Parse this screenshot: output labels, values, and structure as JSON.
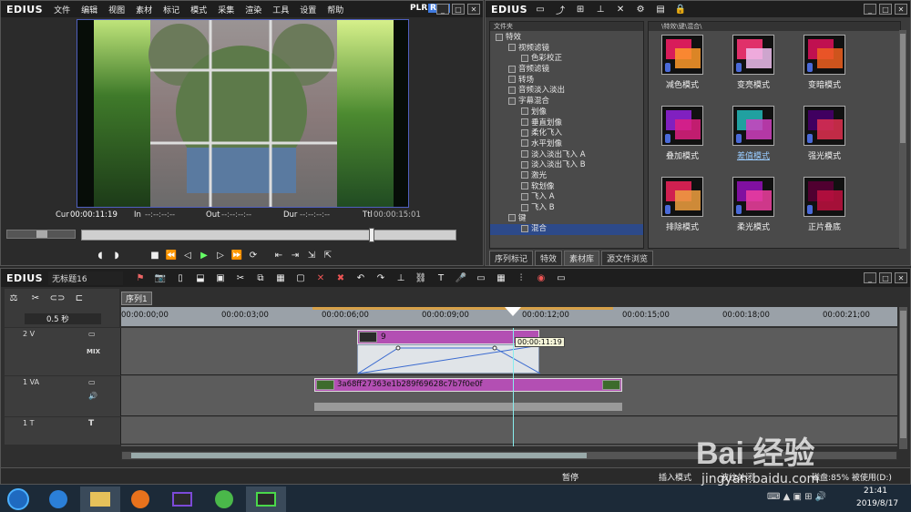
{
  "player": {
    "logo": "EDIUS",
    "menu": [
      "文件",
      "编辑",
      "视图",
      "素材",
      "标记",
      "模式",
      "采集",
      "渲染",
      "工具",
      "设置",
      "帮助"
    ],
    "plr": "PLR",
    "rec": "REC",
    "cur_label": "Cur",
    "cur": "00:00:11:19",
    "in_label": "In",
    "in": "--:--:--:--",
    "out_label": "Out",
    "out": "--:--:--:--",
    "dur_label": "Dur",
    "dur": "--:--:--:--",
    "ttl_label": "Ttl",
    "ttl": "00:00:15:01"
  },
  "bin": {
    "logo": "EDIUS",
    "folder_header": "文件夹",
    "path": "\\特效\\键\\混合\\",
    "tree": [
      {
        "label": "特效",
        "indent": 0
      },
      {
        "label": "视频滤镜",
        "indent": 1
      },
      {
        "label": "色彩校正",
        "indent": 2
      },
      {
        "label": "音频滤镜",
        "indent": 1
      },
      {
        "label": "转场",
        "indent": 1
      },
      {
        "label": "音频淡入淡出",
        "indent": 1
      },
      {
        "label": "字幕混合",
        "indent": 1
      },
      {
        "label": "划像",
        "indent": 2
      },
      {
        "label": "垂直划像",
        "indent": 2
      },
      {
        "label": "柔化飞入",
        "indent": 2
      },
      {
        "label": "水平划像",
        "indent": 2
      },
      {
        "label": "淡入淡出飞入 A",
        "indent": 2
      },
      {
        "label": "淡入淡出飞入 B",
        "indent": 2
      },
      {
        "label": "激光",
        "indent": 2
      },
      {
        "label": "软划像",
        "indent": 2
      },
      {
        "label": "飞入 A",
        "indent": 2
      },
      {
        "label": "飞入 B",
        "indent": 2
      },
      {
        "label": "键",
        "indent": 1
      },
      {
        "label": "混合",
        "indent": 2
      }
    ],
    "effects": [
      "减色模式",
      "变亮模式",
      "变暗模式",
      "叠加模式",
      "差值模式",
      "强光模式",
      "排除模式",
      "柔光模式",
      "正片叠底"
    ],
    "tabs": [
      "序列标记",
      "特效",
      "素材库",
      "源文件浏览"
    ]
  },
  "timeline": {
    "logo": "EDIUS",
    "project": "无标题16",
    "sequence_tab": "序列1",
    "zoom": "0.5 秒",
    "ruler": [
      "00:00:00;00",
      "00:00:03;00",
      "00:00:06;00",
      "00:00:09;00",
      "00:00:12;00",
      "00:00:15;00",
      "00:00:18;00",
      "00:00:21;00"
    ],
    "tracks": {
      "v2": "2 V",
      "mix": "MIX",
      "va1": "1 VA",
      "t1": "1 T"
    },
    "clip_v2": "9",
    "clip_va1": "3a68ff27363e1b289f69628c7b7f0e0f",
    "tooltip": "00:00:11:19"
  },
  "status": {
    "state": "暂停",
    "mode": "插入模式",
    "ripple": "波纹关闭",
    "disk": "磁盘:85% 被使用(D:)"
  },
  "taskbar": {
    "time": "21:41",
    "date": "2019/8/17"
  },
  "watermark": {
    "text": "Bai 经验",
    "url": "jingyan.baidu.com"
  }
}
